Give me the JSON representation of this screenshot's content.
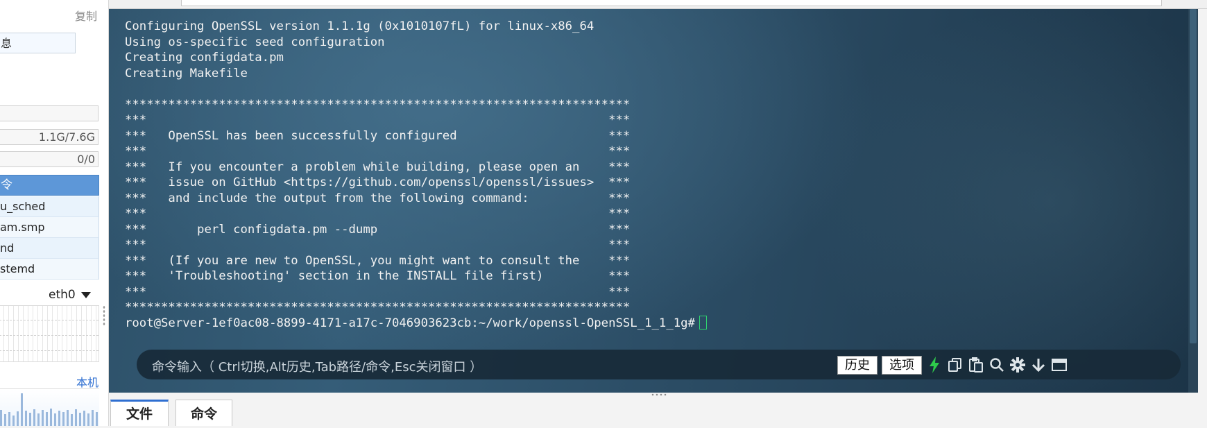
{
  "sidebar": {
    "copy_label": "复制",
    "info_label": "息",
    "empty_field": "",
    "memory_value": "1.1G/7.6G",
    "swap_value": "0/0",
    "process_header": "令",
    "processes": [
      "u_sched",
      "am.smp",
      "nd",
      "stemd"
    ],
    "network_interface": "eth0",
    "local_label": "本机"
  },
  "terminal": {
    "lines": [
      "Configuring OpenSSL version 1.1.1g (0x1010107fL) for linux-x86_64",
      "Using os-specific seed configuration",
      "Creating configdata.pm",
      "Creating Makefile",
      "",
      "**********************************************************************",
      "***                                                                ***",
      "***   OpenSSL has been successfully configured                     ***",
      "***                                                                ***",
      "***   If you encounter a problem while building, please open an    ***",
      "***   issue on GitHub <https://github.com/openssl/openssl/issues>  ***",
      "***   and include the output from the following command:           ***",
      "***                                                                ***",
      "***       perl configdata.pm --dump                                ***",
      "***                                                                ***",
      "***   (If you are new to OpenSSL, you might want to consult the    ***",
      "***   'Troubleshooting' section in the INSTALL file first)         ***",
      "***                                                                ***",
      "**********************************************************************"
    ],
    "prompt": "root@Server-1ef0ac08-8899-4171-a17c-7046903623cb:~/work/openssl-OpenSSL_1_1_1g#"
  },
  "command_bar": {
    "placeholder": "命令输入（ Ctrl切换,Alt历史,Tab路径/命令,Esc关闭窗口 ）",
    "history_label": "历史",
    "options_label": "选项",
    "icons": [
      "lightning-icon",
      "copy-icon",
      "paste-icon",
      "search-icon",
      "gear-icon",
      "download-icon",
      "window-icon"
    ]
  },
  "bottom_tabs": {
    "files_label": "文件",
    "commands_label": "命令"
  },
  "colors": {
    "accent": "#2f6fd1",
    "cursor": "#2fd36f",
    "bolt": "#2ec94b",
    "process_header": "#5d97d8"
  }
}
